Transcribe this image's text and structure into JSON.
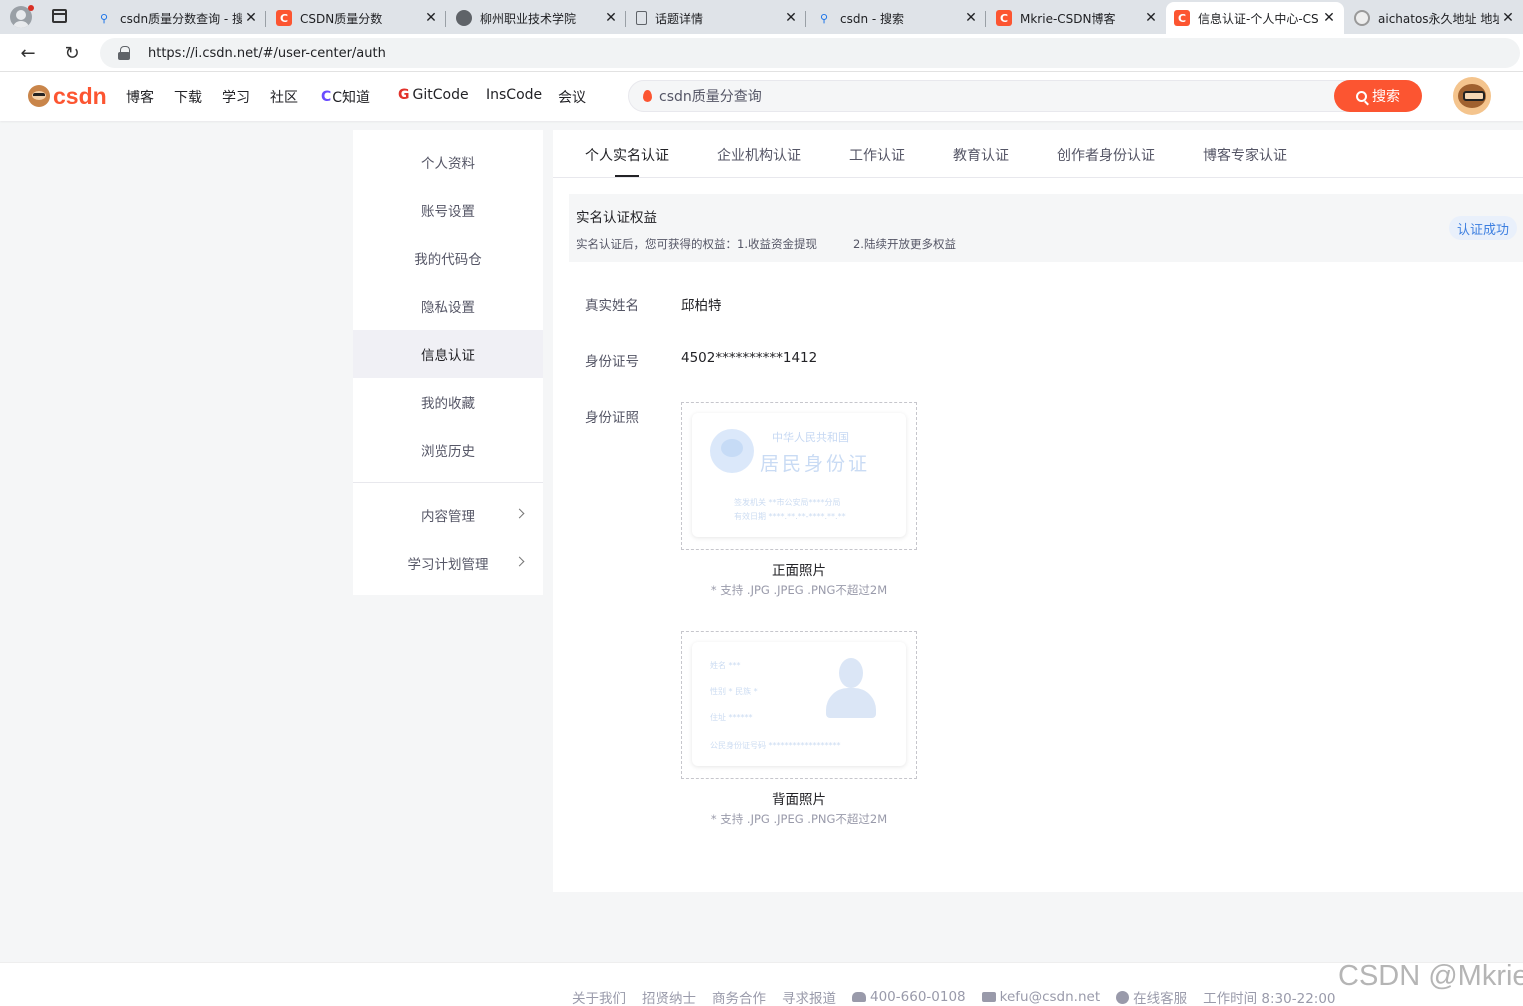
{
  "browser": {
    "tabs": [
      {
        "title": "csdn质量分数查询 - 搜",
        "icon": "search-icon"
      },
      {
        "title": "CSDN质量分数",
        "icon": "csdn-icon"
      },
      {
        "title": "柳州职业技术学院",
        "icon": "globe-icon"
      },
      {
        "title": "话题详情",
        "icon": "document-icon"
      },
      {
        "title": "csdn - 搜索",
        "icon": "search-icon"
      },
      {
        "title": "Mkrie-CSDN博客",
        "icon": "csdn-icon"
      },
      {
        "title": "信息认证-个人中心-CS",
        "icon": "csdn-icon",
        "active": true
      },
      {
        "title": "aichatos永久地址 地址",
        "icon": "ai-icon"
      }
    ],
    "url": "https://i.csdn.net/#/user-center/auth"
  },
  "header": {
    "logo": "CSDN",
    "nav": [
      "博客",
      "下载",
      "学习",
      "社区",
      "C知道",
      "GitCode",
      "InsCode",
      "会议"
    ],
    "search_value": "csdn质量分查询",
    "search_button": "搜索",
    "accent_color": "#fc5531"
  },
  "sidebar": {
    "items": [
      "个人资料",
      "账号设置",
      "我的代码仓",
      "隐私设置",
      "信息认证",
      "我的收藏",
      "浏览历史"
    ],
    "active": "信息认证",
    "groups": [
      "内容管理",
      "学习计划管理"
    ]
  },
  "content": {
    "tabs": [
      "个人实名认证",
      "企业机构认证",
      "工作认证",
      "教育认证",
      "创作者身份认证",
      "博客专家认证"
    ],
    "active_tab": "个人实名认证",
    "benefit": {
      "title": "实名认证权益",
      "desc_prefix": "实名认证后，您可获得的权益：",
      "item1": "1.收益资金提现",
      "item2": "2.陆续开放更多权益",
      "status": "认证成功"
    },
    "fields": {
      "name_label": "真实姓名",
      "name_value": "邱柏特",
      "id_label": "身份证号",
      "id_value": "4502**********1412",
      "photo_label": "身份证照"
    },
    "front_card": {
      "title": "中华人民共和国",
      "subtitle": "居民身份证",
      "line1": "签发机关 **市公安局****分局",
      "line2": "有效日期 ****.**.**-****.**.**"
    },
    "back_card": {
      "line1": "姓名 ***",
      "line2": "性别 * 民族 *",
      "line3": "住址 ******",
      "line4": "公民身份证号码 ******************"
    },
    "front_caption": "正面照片",
    "back_caption": "背面照片",
    "hint": "* 支持 .JPG .JPEG .PNG不超过2M"
  },
  "footer": {
    "links": [
      "关于我们",
      "招贤纳士",
      "商务合作",
      "寻求报道"
    ],
    "phone": "400-660-0108",
    "email": "kefu@csdn.net",
    "service": "在线客服",
    "hours": "工作时间 8:30-22:00",
    "watermark": "CSDN @Mkrie"
  }
}
